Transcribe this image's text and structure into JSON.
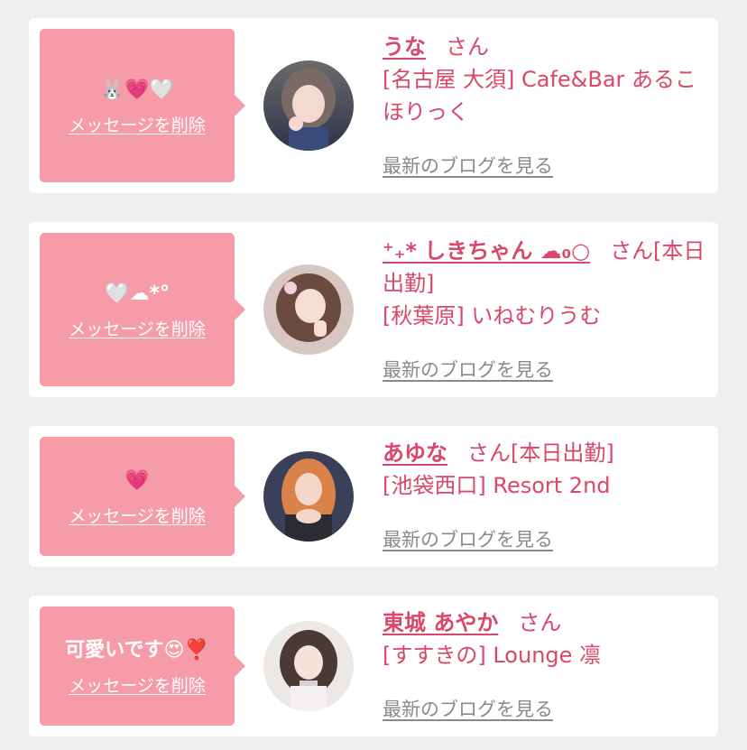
{
  "colors": {
    "background": "#efefef",
    "card": "#ffffff",
    "bubble": "#f69ca8",
    "accent": "#d9476a",
    "link_gray": "#8a8a8a"
  },
  "entries": [
    {
      "message": "🐰💗🤍",
      "delete_label": "メッセージを削除",
      "name": "うな",
      "suffix": "さん",
      "shop": "[名古屋 大須] Cafe&Bar あるこほりっく",
      "blog_label": "最新のブログを見る",
      "avatar_icon": "avatar-photo"
    },
    {
      "message": "🤍☁*°",
      "delete_label": "メッセージを削除",
      "name": "⁺₊* しきちゃん ☁₀○",
      "suffix": "さん[本日出勤]",
      "shop": "[秋葉原] いねむりうむ",
      "blog_label": "最新のブログを見る",
      "avatar_icon": "avatar-photo"
    },
    {
      "message": "💗",
      "delete_label": "メッセージを削除",
      "name": "あゆな",
      "suffix": "さん[本日出勤]",
      "shop": "[池袋西口] Resort 2nd",
      "blog_label": "最新のブログを見る",
      "avatar_icon": "avatar-photo"
    },
    {
      "message": "可愛いです😍❣️",
      "delete_label": "メッセージを削除",
      "name": "東城 あやか",
      "suffix": "さん",
      "shop": "[すすきの] Lounge 凛",
      "blog_label": "最新のブログを見る",
      "avatar_icon": "avatar-photo"
    }
  ]
}
